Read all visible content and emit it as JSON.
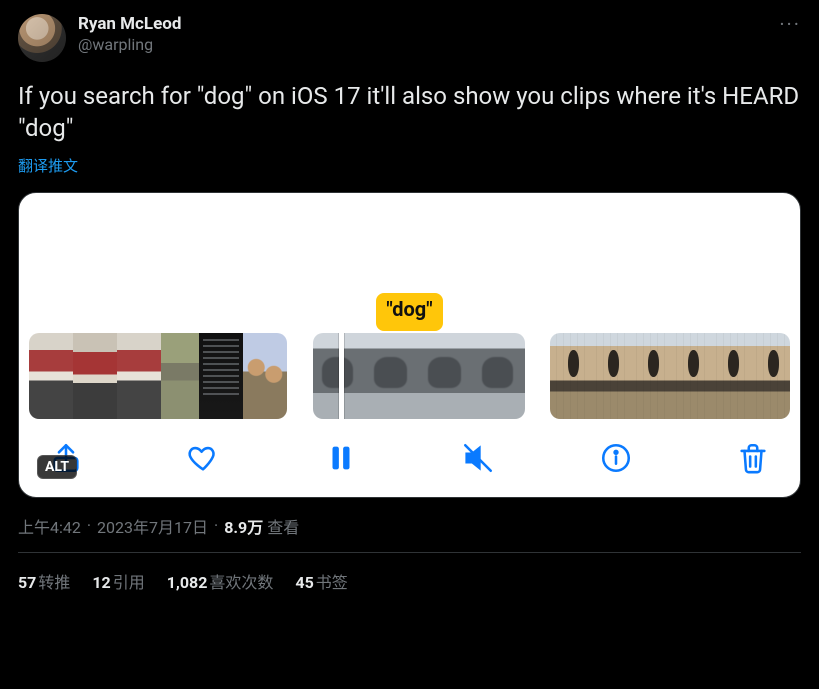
{
  "user": {
    "name": "Ryan McLeod",
    "handle": "@warpling"
  },
  "body": {
    "text": "If you search for \"dog\" on iOS 17 it'll also show you clips where it's HEARD \"dog\""
  },
  "translate_link": "翻译推文",
  "media": {
    "bubble_text": "\"dog\"",
    "alt_badge": "ALT",
    "toolbar": {
      "share": "share-icon",
      "like": "heart-icon",
      "pause": "pause-icon",
      "mute": "mute-icon",
      "info": "info-icon",
      "trash": "trash-icon"
    }
  },
  "meta": {
    "time": "上午4:42",
    "date": "2023年7月17日",
    "views_count": "8.9万",
    "views_label": "查看"
  },
  "stats": {
    "retweets_count": "57",
    "retweets_label": "转推",
    "quotes_count": "12",
    "quotes_label": "引用",
    "likes_count": "1,082",
    "likes_label": "喜欢次数",
    "bookmarks_count": "45",
    "bookmarks_label": "书签"
  }
}
